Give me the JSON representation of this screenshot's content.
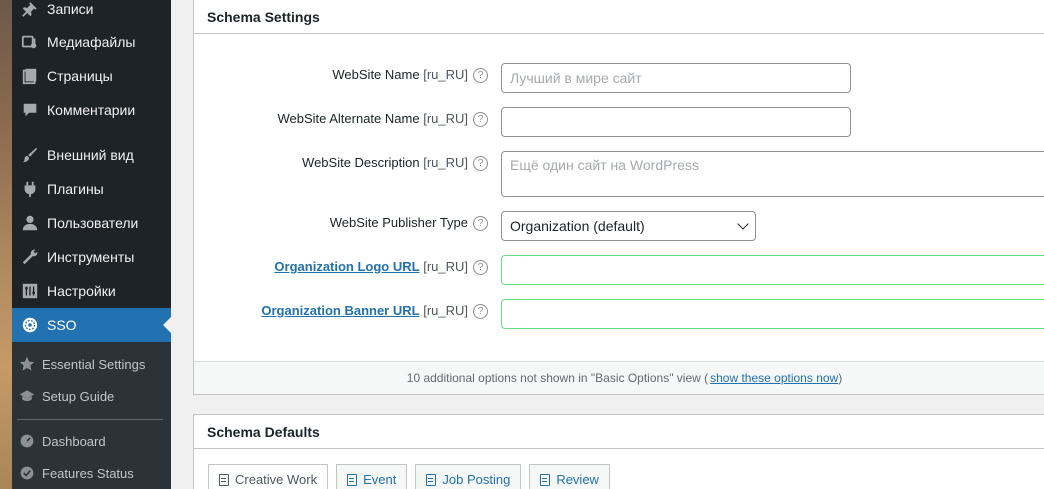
{
  "sidebar": {
    "menu": [
      {
        "label": "Записи",
        "icon": "pushpin-icon"
      },
      {
        "label": "Медиафайлы",
        "icon": "media-icon"
      },
      {
        "label": "Страницы",
        "icon": "pages-icon"
      },
      {
        "label": "Комментарии",
        "icon": "comments-icon"
      },
      {
        "label": "Внешний вид",
        "icon": "paintbrush-icon"
      },
      {
        "label": "Плагины",
        "icon": "plugins-icon"
      },
      {
        "label": "Пользователи",
        "icon": "users-icon"
      },
      {
        "label": "Инструменты",
        "icon": "wrench-icon"
      },
      {
        "label": "Настройки",
        "icon": "settings-icon"
      },
      {
        "label": "SSO",
        "icon": "sso-icon"
      }
    ],
    "submenu": [
      {
        "label": "Essential Settings",
        "icon": "star-icon"
      },
      {
        "label": "Setup Guide",
        "icon": "graduation-cap-icon"
      },
      {
        "label": "Dashboard",
        "icon": "dashboard-icon"
      },
      {
        "label": "Features Status",
        "icon": "check-circle-icon"
      }
    ],
    "active_color": "#2271b1"
  },
  "schema_settings": {
    "title": "Schema Settings",
    "fields": [
      {
        "label": "WebSite Name",
        "lang": "[ru_RU]",
        "placeholder": "Лучший в мире сайт",
        "value": ""
      },
      {
        "label": "WebSite Alternate Name",
        "lang": "[ru_RU]",
        "placeholder": "",
        "value": ""
      },
      {
        "label": "WebSite Description",
        "lang": "[ru_RU]",
        "placeholder": "Ещё один сайт на WordPress",
        "value": ""
      },
      {
        "label": "WebSite Publisher Type",
        "lang": "",
        "placeholder": "",
        "value": "Organization (default)"
      },
      {
        "label": "Organization Logo URL",
        "lang": "[ru_RU]",
        "placeholder": "",
        "value": ""
      },
      {
        "label": "Organization Banner URL",
        "lang": "[ru_RU]",
        "placeholder": "",
        "value": ""
      }
    ],
    "help_glyph": "?",
    "footer_text": "10 additional options not shown in \"Basic Options\" view (",
    "footer_link": "show these options now",
    "footer_close": ")"
  },
  "schema_defaults": {
    "title": "Schema Defaults",
    "tabs": [
      {
        "label": "Creative Work"
      },
      {
        "label": "Event"
      },
      {
        "label": "Job Posting"
      },
      {
        "label": "Review"
      }
    ]
  }
}
